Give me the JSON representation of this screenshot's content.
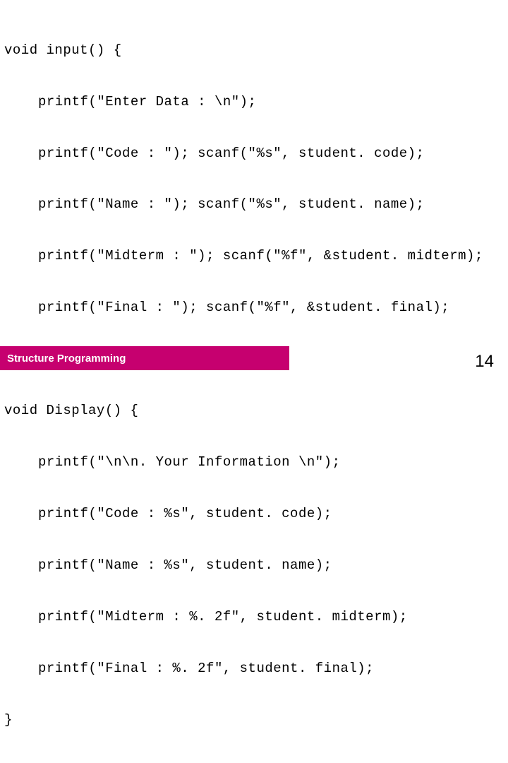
{
  "code": {
    "l1": "void input() {",
    "l2": "printf(\"Enter Data : \\n\");",
    "l3": "printf(\"Code : \"); scanf(\"%s\", student. code);",
    "l4": "printf(\"Name : \"); scanf(\"%s\", student. name);",
    "l5": "printf(\"Midterm : \"); scanf(\"%f\", &student. midterm);",
    "l6": "printf(\"Final : \"); scanf(\"%f\", &student. final);",
    "l7": "}",
    "l8": "void Display() {",
    "l9": "printf(\"\\n\\n. Your Information \\n\");",
    "l10": "printf(\"Code : %s\", student. code);",
    "l11": "printf(\"Name : %s\", student. name);",
    "l12": "printf(\"Midterm : %. 2f\", student. midterm);",
    "l13": "printf(\"Final : %. 2f\", student. final);",
    "l14": "}"
  },
  "footer": {
    "label": "Structure Programming"
  },
  "page": "14"
}
